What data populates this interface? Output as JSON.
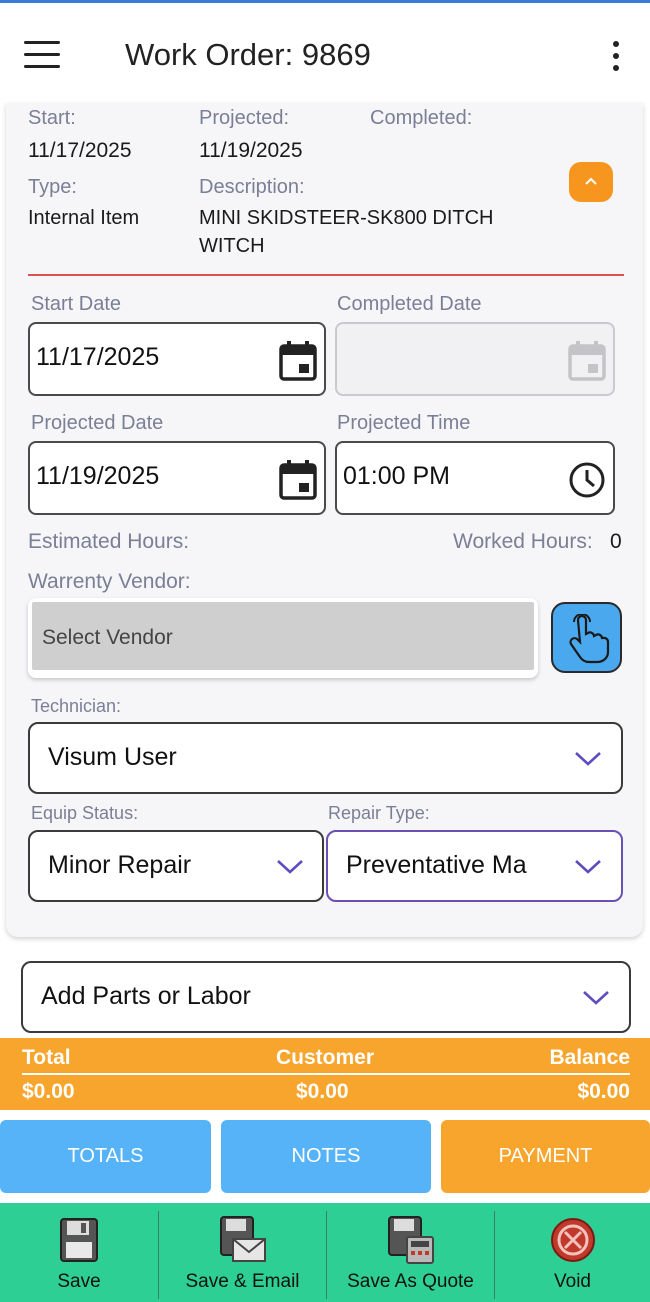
{
  "header": {
    "title": "Work Order: 9869"
  },
  "summary": {
    "start_label": "Start:",
    "start_value": "11/17/2025",
    "projected_label": "Projected:",
    "projected_value": "11/19/2025",
    "completed_label": "Completed:",
    "completed_value": "",
    "type_label": "Type:",
    "type_value": "Internal Item",
    "description_label": "Description:",
    "description_line1": "MINI SKIDSTEER-SK800 DITCH",
    "description_line2": "WITCH"
  },
  "form": {
    "start_date_label": "Start Date",
    "start_date_value": "11/17/2025",
    "completed_date_label": "Completed Date",
    "completed_date_value": "",
    "projected_date_label": "Projected Date",
    "projected_date_value": "11/19/2025",
    "projected_time_label": "Projected Time",
    "projected_time_value": "01:00 PM",
    "estimated_hours_label": "Estimated Hours:",
    "worked_hours_label": "Worked Hours:",
    "worked_hours_value": "0",
    "vendor_label": "Warrenty Vendor:",
    "vendor_placeholder": "Select Vendor",
    "technician_label": "Technician:",
    "technician_value": "Visum User",
    "equip_status_label": "Equip Status:",
    "equip_status_value": "Minor Repair",
    "repair_type_label": "Repair Type:",
    "repair_type_value": "Preventative Ma"
  },
  "parts": {
    "label": "Add Parts or Labor"
  },
  "totals": {
    "total_label": "Total",
    "total_value": "$0.00",
    "customer_label": "Customer",
    "customer_value": "$0.00",
    "balance_label": "Balance",
    "balance_value": "$0.00"
  },
  "tabs": [
    {
      "label": "TOTALS"
    },
    {
      "label": "NOTES"
    },
    {
      "label": "PAYMENT"
    }
  ],
  "toolbar": {
    "save": "Save",
    "save_email": "Save & Email",
    "save_quote": "Save As Quote",
    "void": "Void"
  },
  "colors": {
    "accent_orange": "#f7a52d",
    "accent_blue": "#56b3f8",
    "toolbar_green": "#2ecf94",
    "divider_red": "#e05050",
    "select_active": "#6a50b5"
  }
}
